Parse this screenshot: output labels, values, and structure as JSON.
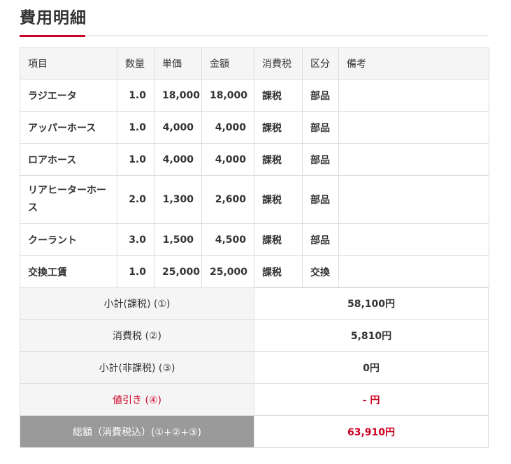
{
  "title": "費用明細",
  "colors": {
    "accent": "#cc0022",
    "header_bg": "#f5f5f5",
    "grand_total_bg": "#9a9a9a"
  },
  "table": {
    "headers": [
      "項目",
      "数量",
      "単価",
      "金額",
      "消費税",
      "区分",
      "備考"
    ],
    "rows": [
      {
        "item": "ラジエータ",
        "qty": "1.0",
        "unit_price": "18,000",
        "amount": "18,000",
        "tax": "課税",
        "category": "部品",
        "note": ""
      },
      {
        "item": "アッパーホース",
        "qty": "1.0",
        "unit_price": "4,000",
        "amount": "4,000",
        "tax": "課税",
        "category": "部品",
        "note": ""
      },
      {
        "item": "ロアホース",
        "qty": "1.0",
        "unit_price": "4,000",
        "amount": "4,000",
        "tax": "課税",
        "category": "部品",
        "note": ""
      },
      {
        "item": "リアヒーターホース",
        "qty": "2.0",
        "unit_price": "1,300",
        "amount": "2,600",
        "tax": "課税",
        "category": "部品",
        "note": ""
      },
      {
        "item": "クーラント",
        "qty": "3.0",
        "unit_price": "1,500",
        "amount": "4,500",
        "tax": "課税",
        "category": "部品",
        "note": ""
      },
      {
        "item": "交換工賃",
        "qty": "1.0",
        "unit_price": "25,000",
        "amount": "25,000",
        "tax": "課税",
        "category": "交換",
        "note": ""
      }
    ]
  },
  "totals": {
    "subtotal_taxable": {
      "label": "小計(課税) (①)",
      "value": "58,100円"
    },
    "consumption_tax": {
      "label": "消費税 (②)",
      "value": "5,810円"
    },
    "subtotal_nontaxable": {
      "label": "小計(非課税) (③)",
      "value": "0円"
    },
    "discount": {
      "label": "値引き (④)",
      "value": "- 円"
    },
    "grand_total": {
      "label": "総額（消費税込）(①+②+③)",
      "value": "63,910円"
    }
  }
}
